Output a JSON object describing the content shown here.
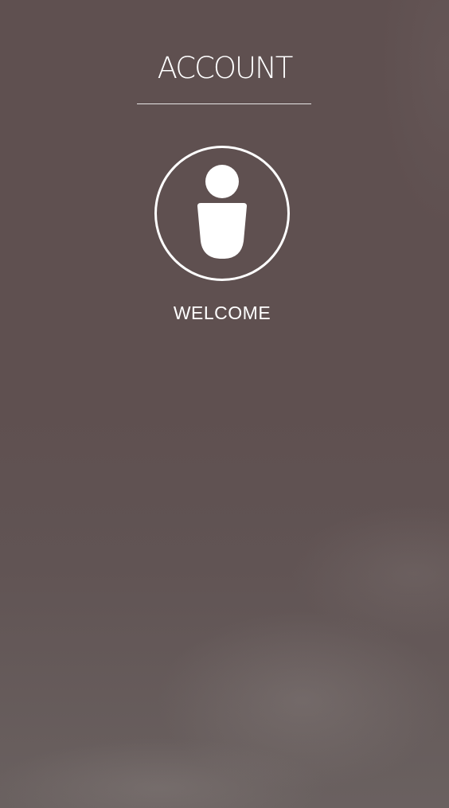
{
  "header": {
    "title": "ACCOUNT"
  },
  "profile": {
    "icon": "user-icon",
    "greeting": "WELCOME"
  },
  "colors": {
    "background": "#5e4f4f",
    "foreground": "#ffffff"
  }
}
